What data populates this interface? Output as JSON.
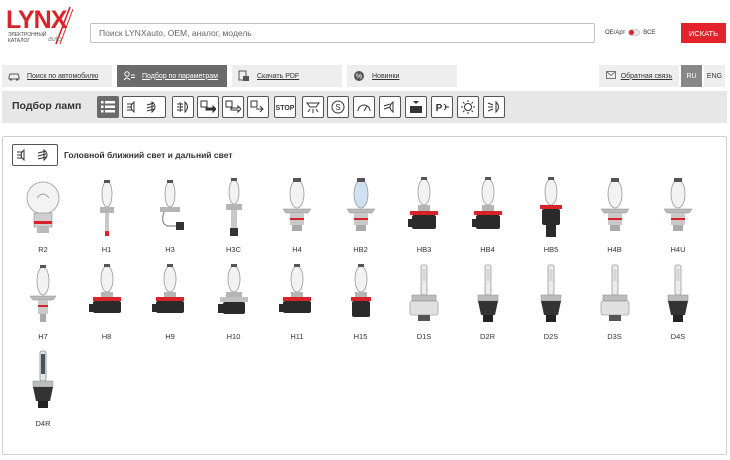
{
  "header": {
    "logo_text": "LYNX",
    "logo_sub": "ЭЛЕКТРОННЫЙ КАТАЛОГ",
    "logo_auto": "auto",
    "search_placeholder": "Поиск LYNXauto, OEM, аналог, модель",
    "toggle_left": "OE/Арт",
    "toggle_right": "ВСЕ",
    "search_button": "ИСКАТЬ",
    "brand_color": "#e2232b"
  },
  "tabs": [
    {
      "label": "Поиск по автомобилю",
      "icon": "car-icon"
    },
    {
      "label": "Подбор по параметрам",
      "icon": "params-icon"
    },
    {
      "label": "Скачать PDF",
      "icon": "pdf-icon"
    },
    {
      "label": "Новинки",
      "icon": "news-icon"
    }
  ],
  "right": {
    "feedback": "Обратная связь",
    "lang_ru": "RU",
    "lang_en": "ENG"
  },
  "lampbar": {
    "title": "Подбор ламп",
    "icons": [
      "list-icon",
      "low-high-beam-icon",
      "fog-front-icon",
      "turn-signal-icon",
      "side-marker-icon",
      "reverse-icon",
      "stop-icon",
      "interior-light-icon",
      "parking-s-icon",
      "dashboard-icon",
      "high-beam-icon",
      "plate-light-icon",
      "parking-p-icon",
      "warning-light-icon",
      "daytime-light-icon"
    ]
  },
  "section": {
    "title": "Головной ближний свет и дальний свет"
  },
  "lamps": [
    {
      "label": "R2",
      "kind": "globe"
    },
    {
      "label": "H1",
      "kind": "h1"
    },
    {
      "label": "H3",
      "kind": "h3"
    },
    {
      "label": "H3C",
      "kind": "h3c"
    },
    {
      "label": "H4",
      "kind": "h4"
    },
    {
      "label": "HB2",
      "kind": "hb2"
    },
    {
      "label": "HB3",
      "kind": "hb"
    },
    {
      "label": "HB4",
      "kind": "hb"
    },
    {
      "label": "HB5",
      "kind": "hb5"
    },
    {
      "label": "H4B",
      "kind": "h4"
    },
    {
      "label": "H4U",
      "kind": "h4"
    },
    {
      "label": "H7",
      "kind": "h7"
    },
    {
      "label": "H8",
      "kind": "h8"
    },
    {
      "label": "H9",
      "kind": "h8"
    },
    {
      "label": "H10",
      "kind": "h10"
    },
    {
      "label": "H11",
      "kind": "h8"
    },
    {
      "label": "H15",
      "kind": "h15"
    },
    {
      "label": "D1S",
      "kind": "d1s"
    },
    {
      "label": "D2R",
      "kind": "d2"
    },
    {
      "label": "D2S",
      "kind": "d2"
    },
    {
      "label": "D3S",
      "kind": "d1s"
    },
    {
      "label": "D4S",
      "kind": "d2"
    },
    {
      "label": "D4R",
      "kind": "d4r"
    }
  ]
}
